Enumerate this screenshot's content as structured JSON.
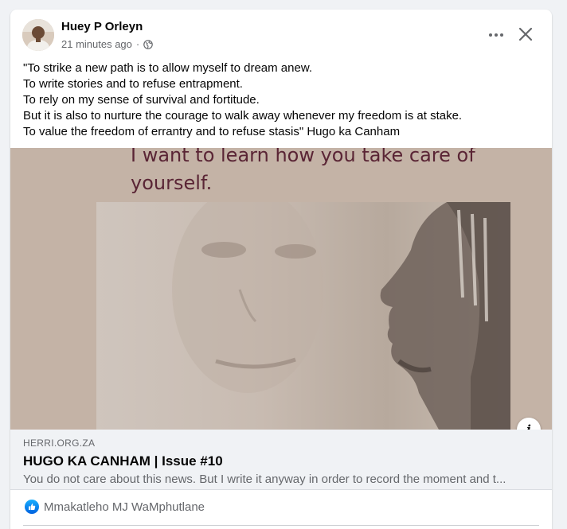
{
  "post": {
    "author": "Huey P Orleyn",
    "time": "21 minutes ago",
    "separator": "·",
    "privacy_icon": "globe-icon",
    "more_icon": "•••",
    "close_icon": "close-icon",
    "text_lines": [
      "\"To strike a new path is to allow myself to dream anew.",
      "To write stories and to refuse entrapment.",
      "To rely on my sense of survival and fortitude.",
      "But it is also to nurture the courage to walk away whenever my freedom is at stake.",
      "To value the freedom of errantry and to refuse stasis\" Hugo ka Canham"
    ]
  },
  "link_preview": {
    "image_caption": "I want to learn how you take care of yourself.",
    "info_icon": "i",
    "domain": "HERRI.ORG.ZA",
    "title": "HUGO KA CANHAM | Issue #10",
    "description": "You do not care about this news. But I write it anyway in order to record the moment and t..."
  },
  "reactions": {
    "icon": "like-icon",
    "names": "Mmakatleho MJ WaMphutlane"
  },
  "colors": {
    "like_blue": "#1877f2",
    "caption": "#5a2535",
    "secondary_text": "#65676b"
  }
}
